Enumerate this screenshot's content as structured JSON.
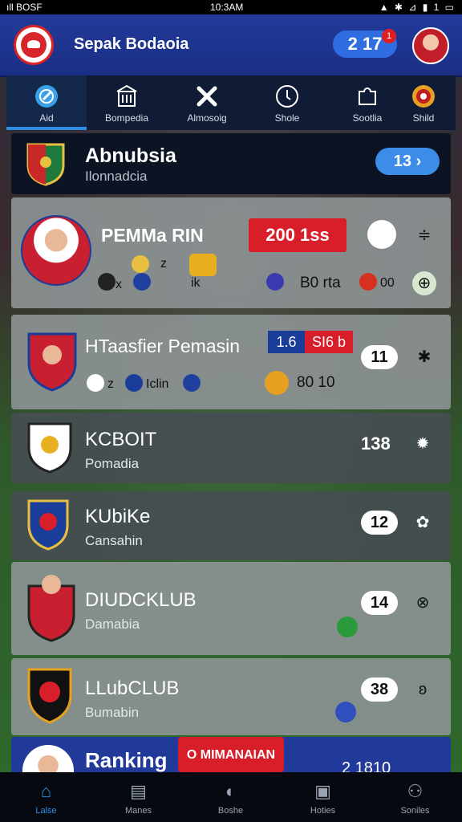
{
  "status_bar": {
    "left": "ıll BOSF",
    "time": "10:3AM",
    "right": "▲ ✱ ⊿ ▮ 1 ▭"
  },
  "header": {
    "title": "Sepak Bodaoia",
    "badge_value": "2 17",
    "notif_count": "1"
  },
  "tabs": [
    {
      "label": "Aid",
      "icon": "target-icon",
      "glyph": "◎"
    },
    {
      "label": "Bompedia",
      "icon": "building-icon",
      "glyph": "⌂"
    },
    {
      "label": "Almosoig",
      "icon": "shuffle-icon",
      "glyph": "✕"
    },
    {
      "label": "Shole",
      "icon": "clock-icon",
      "glyph": "◔"
    },
    {
      "label": "Sootlia",
      "icon": "puzzle-icon",
      "glyph": "♣"
    },
    {
      "label": "Shild",
      "icon": "shield-icon",
      "glyph": "⛨"
    }
  ],
  "hero": {
    "title": "Abnubsia",
    "subtitle": "Ilonnadcia",
    "button": "13 ›"
  },
  "feature": {
    "player": "PEMMa RIN",
    "red_banner": "200  1ss",
    "stat_a": "B0 rta",
    "stat_b": "00",
    "mini_x": "x",
    "mini_z": "z",
    "mini_ik": "ik"
  },
  "transfer": {
    "title": "HTaasfier Pemasin",
    "blue": "1.6",
    "red": "SI6 b",
    "score": "11",
    "mini_1": "z",
    "mini_2": "Iclin",
    "score2": "80 10"
  },
  "clubs": [
    {
      "name": "KCBOIT",
      "sub": "Pomadia",
      "score": "138"
    },
    {
      "name": "KUbiKe",
      "sub": "Cansahin",
      "score": "12"
    },
    {
      "name": "DIUDCKLUB",
      "sub": "Damabia",
      "score": "14"
    },
    {
      "name": "LLubCLUB",
      "sub": "Bumabin",
      "score": "38"
    }
  ],
  "ranking": {
    "title": "Ranking",
    "badge": "O MIMANAIAN",
    "value": "2 1810"
  },
  "bottom_nav": [
    {
      "label": "Lalse",
      "icon": "home-icon",
      "glyph": "⌂"
    },
    {
      "label": "Manes",
      "icon": "list-icon",
      "glyph": "▤"
    },
    {
      "label": "Boshe",
      "icon": "ball-icon",
      "glyph": "◐"
    },
    {
      "label": "Hoties",
      "icon": "calendar-icon",
      "glyph": "▣"
    },
    {
      "label": "Soniles",
      "icon": "profile-icon",
      "glyph": "⚇"
    }
  ],
  "colors": {
    "primary": "#2f8ce0",
    "header": "#233a9a",
    "accent_red": "#d8242b"
  }
}
